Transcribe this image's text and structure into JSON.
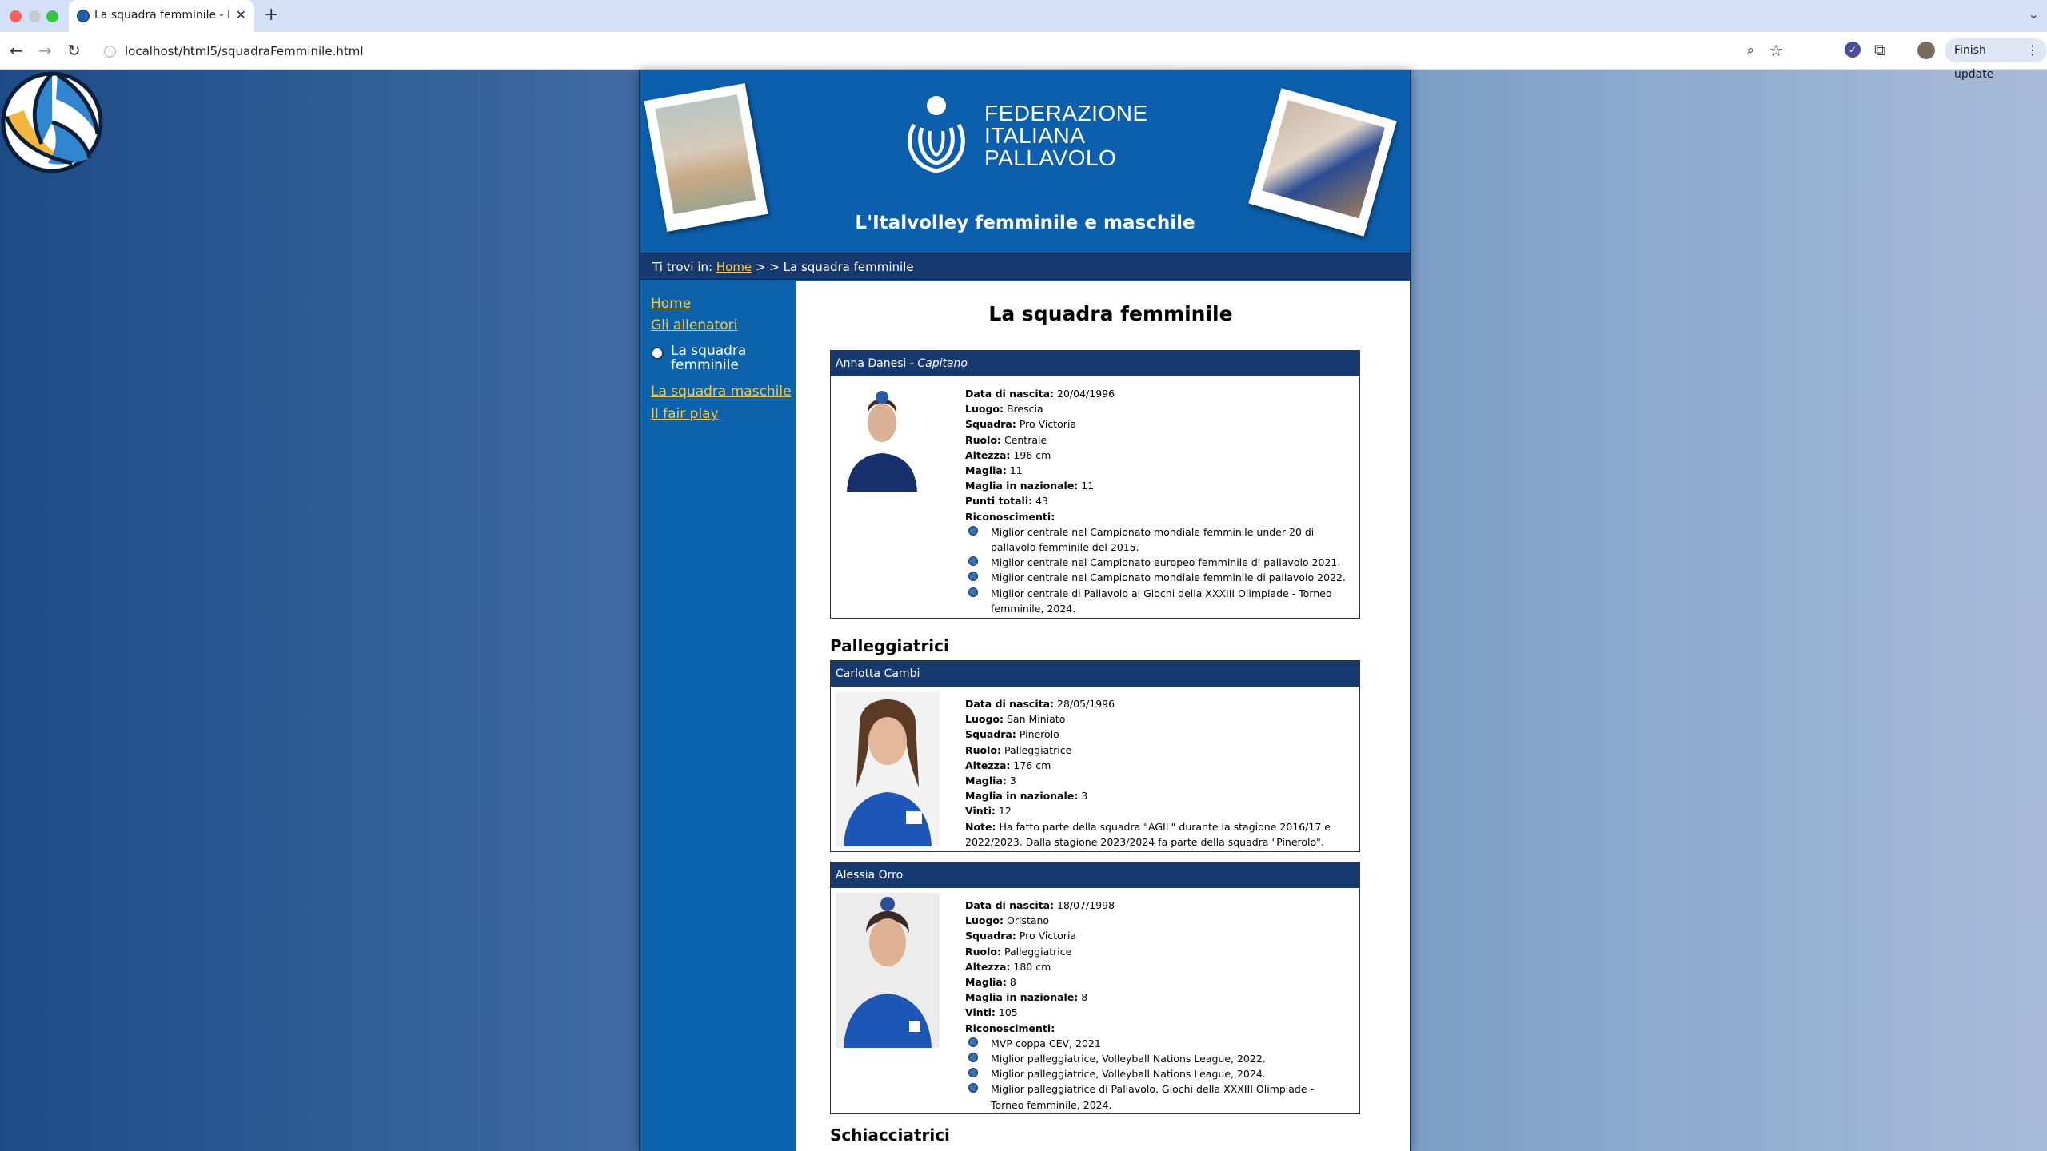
{
  "browser": {
    "tab_title": "La squadra femminile - Italvo",
    "url": "localhost/html5/squadraFemminile.html",
    "update_button": "Finish update"
  },
  "header": {
    "federation_lines": [
      "FEDERAZIONE",
      "ITALIANA",
      "PALLAVOLO"
    ],
    "subtitle": "L'Italvolley femminile e maschile"
  },
  "breadcrumb": {
    "prefix": "Ti trovi in:",
    "home": "Home",
    "separator": "> >",
    "current": "La squadra femminile"
  },
  "sidebar": {
    "items": [
      {
        "label": "Home"
      },
      {
        "label": "Gli allenatori"
      },
      {
        "label": "La squadra femminile"
      },
      {
        "label": "La squadra maschile"
      },
      {
        "label": "Il fair play"
      }
    ]
  },
  "main": {
    "title": "La squadra femminile",
    "sections": [
      "Palleggiatrici",
      "Schiacciatrici"
    ],
    "players": [
      {
        "name": "Anna Danesi",
        "role_tag": "Capitano",
        "fields": [
          {
            "label": "Data di nascita:",
            "value": "20/04/1996"
          },
          {
            "label": "Luogo:",
            "value": "Brescia"
          },
          {
            "label": "Squadra:",
            "value": "Pro Victoria"
          },
          {
            "label": "Ruolo:",
            "value": "Centrale"
          },
          {
            "label": "Altezza:",
            "value": "196 cm"
          },
          {
            "label": "Maglia:",
            "value": "11"
          },
          {
            "label": "Maglia in nazionale:",
            "value": "11"
          },
          {
            "label": "Punti totali:",
            "value": "43"
          }
        ],
        "awards_label": "Riconoscimenti:",
        "awards": [
          "Miglior centrale nel Campionato mondiale femminile under 20 di pallavolo femminile del 2015.",
          "Miglior centrale nel Campionato europeo femminile di pallavolo 2021.",
          "Miglior centrale nel Campionato mondiale femminile di pallavolo 2022.",
          "Miglior centrale di Pallavolo ai Giochi della XXXIII Olimpiade - Torneo femminile, 2024."
        ]
      },
      {
        "name": "Carlotta Cambi",
        "fields": [
          {
            "label": "Data di nascita:",
            "value": "28/05/1996"
          },
          {
            "label": "Luogo:",
            "value": "San Miniato"
          },
          {
            "label": "Squadra:",
            "value": "Pinerolo"
          },
          {
            "label": "Ruolo:",
            "value": "Palleggiatrice"
          },
          {
            "label": "Altezza:",
            "value": "176 cm"
          },
          {
            "label": "Maglia:",
            "value": "3"
          },
          {
            "label": "Maglia in nazionale:",
            "value": "3"
          },
          {
            "label": "Vinti:",
            "value": "12"
          },
          {
            "label": "Note:",
            "value": "Ha fatto parte della squadra \"AGIL\" durante la stagione 2016/17 e 2022/2023. Dalla stagione 2023/2024 fa parte della squadra \"Pinerolo\"."
          }
        ]
      },
      {
        "name": "Alessia Orro",
        "fields": [
          {
            "label": "Data di nascita:",
            "value": "18/07/1998"
          },
          {
            "label": "Luogo:",
            "value": "Oristano"
          },
          {
            "label": "Squadra:",
            "value": "Pro Victoria"
          },
          {
            "label": "Ruolo:",
            "value": "Palleggiatrice"
          },
          {
            "label": "Altezza:",
            "value": "180 cm"
          },
          {
            "label": "Maglia:",
            "value": "8"
          },
          {
            "label": "Maglia in nazionale:",
            "value": "8"
          },
          {
            "label": "Vinti:",
            "value": "105"
          }
        ],
        "awards_label": "Riconoscimenti:",
        "awards": [
          "MVP coppa CEV, 2021",
          "Miglior palleggiatrice, Volleyball Nations League, 2022.",
          "Miglior palleggiatrice, Volleyball Nations League, 2024.",
          "Miglior palleggiatrice di Pallavolo, Giochi della XXXIII Olimpiade - Torneo femminile, 2024."
        ]
      }
    ]
  }
}
